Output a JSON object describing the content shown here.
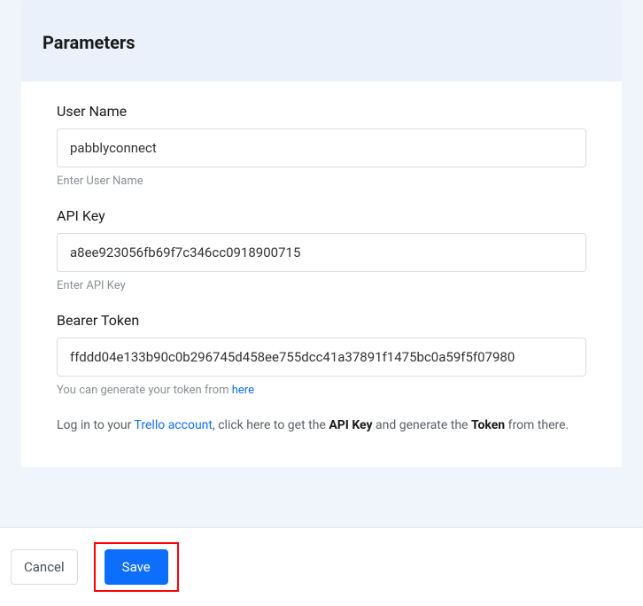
{
  "panel": {
    "title": "Parameters"
  },
  "fields": {
    "username": {
      "label": "User Name",
      "value": "pabblyconnect",
      "hint": "Enter User Name"
    },
    "apikey": {
      "label": "API Key",
      "value": "a8ee923056fb69f7c346cc0918900715",
      "hint": "Enter API Key"
    },
    "bearer": {
      "label": "Bearer Token",
      "value": "ffddd04e133b90c0b296745d458ee755dcc41a37891f1475bc0a59f5f07980",
      "hintPrefix": "You can generate your token from ",
      "hintLink": "here"
    }
  },
  "info": {
    "part1": "Log in to your ",
    "link": "Trello account",
    "part2": ", click here to get the ",
    "bold1": "API Key",
    "part3": " and generate the ",
    "bold2": "Token",
    "part4": " from there."
  },
  "footer": {
    "cancel": "Cancel",
    "save": "Save"
  }
}
